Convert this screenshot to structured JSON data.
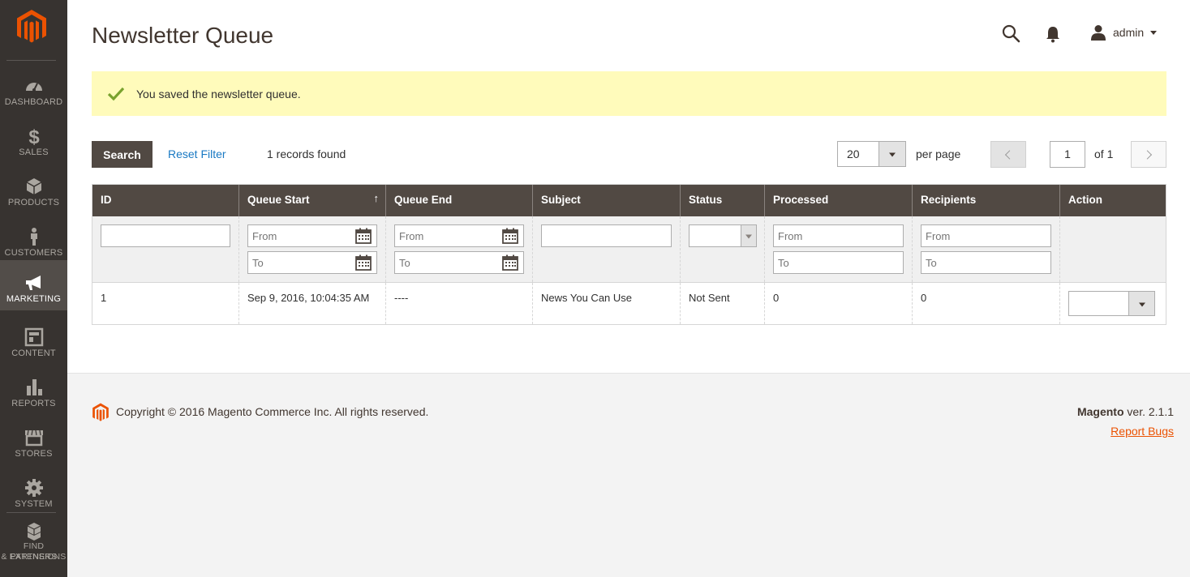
{
  "sidebar": {
    "logo": "magento-logo",
    "items": [
      {
        "label": "DASHBOARD",
        "icon": "dashboard-icon"
      },
      {
        "label": "SALES",
        "icon": "dollar-icon"
      },
      {
        "label": "PRODUCTS",
        "icon": "cube-icon"
      },
      {
        "label": "CUSTOMERS",
        "icon": "person-icon"
      },
      {
        "label": "MARKETING",
        "icon": "megaphone-icon",
        "active": true
      },
      {
        "label": "CONTENT",
        "icon": "layout-icon"
      },
      {
        "label": "REPORTS",
        "icon": "bar-chart-icon"
      },
      {
        "label": "STORES",
        "icon": "storefront-icon"
      },
      {
        "label": "SYSTEM",
        "icon": "gear-icon"
      },
      {
        "label": "FIND PARTNERS & EXTENSIONS",
        "label_line1": "FIND PARTNERS",
        "label_line2": "& EXTENSIONS",
        "icon": "boxes-icon"
      }
    ]
  },
  "header": {
    "title": "Newsletter Queue",
    "user": "admin"
  },
  "message": {
    "text": "You saved the newsletter queue.",
    "type": "success"
  },
  "toolbar": {
    "search_label": "Search",
    "reset_label": "Reset Filter",
    "records_text": "1 records found",
    "per_page_value": "20",
    "per_page_label": "per page",
    "page_value": "1",
    "page_of": "of 1"
  },
  "grid": {
    "columns": [
      "ID",
      "Queue Start",
      "Queue End",
      "Subject",
      "Status",
      "Processed",
      "Recipients",
      "Action"
    ],
    "sorted_column": "Queue Start",
    "filter_placeholders": {
      "from": "From",
      "to": "To"
    },
    "rows": [
      {
        "id": "1",
        "queue_start": "Sep 9, 2016, 10:04:35 AM",
        "queue_end": "----",
        "subject": "News You Can Use",
        "status": "Not Sent",
        "processed": "0",
        "recipients": "0"
      }
    ]
  },
  "footer": {
    "copyright": "Copyright © 2016 Magento Commerce Inc. All rights reserved.",
    "brand": "Magento",
    "version": " ver. 2.1.1",
    "report_bugs": "Report Bugs"
  },
  "colors": {
    "sidebar_bg": "#373330",
    "active_nav": "#524d49",
    "brand_orange": "#eb5202",
    "grid_header": "#514943",
    "message_bg": "#fffbbb",
    "link_blue": "#1979c3"
  }
}
